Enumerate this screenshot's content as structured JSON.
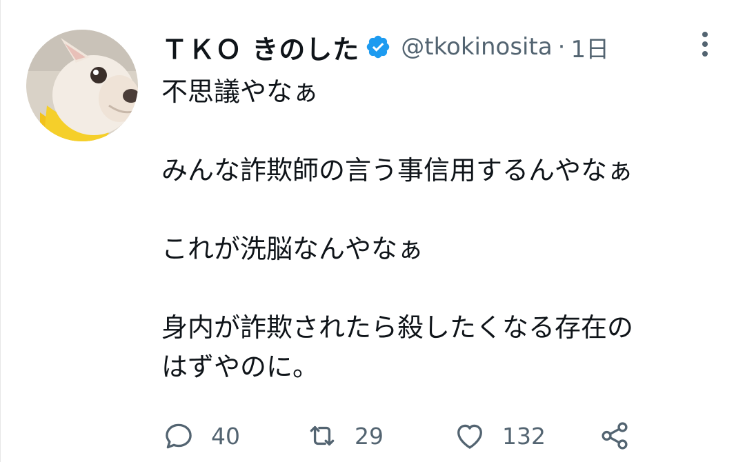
{
  "tweet": {
    "display_name": "ＴＫＯ きのした",
    "handle": "@tkokinosita",
    "separator": "·",
    "time": "1日",
    "verified": true,
    "avatar_icon": "french-bulldog-avatar",
    "text_lines": [
      "不思議やなぁ",
      "",
      "みんな詐欺師の言う事信用するんやなぁ",
      "",
      "これが洗脳なんやなぁ",
      "",
      "身内が詐欺されたら殺したくなる存在の",
      "はずやのに。"
    ],
    "actions": {
      "reply": {
        "icon": "reply-icon",
        "count": "40"
      },
      "retweet": {
        "icon": "retweet-icon",
        "count": "29"
      },
      "like": {
        "icon": "heart-icon",
        "count": "132"
      },
      "share": {
        "icon": "share-icon"
      }
    },
    "colors": {
      "text": "#0f1419",
      "secondary": "#536471",
      "verified": "#1d9bf0"
    }
  }
}
